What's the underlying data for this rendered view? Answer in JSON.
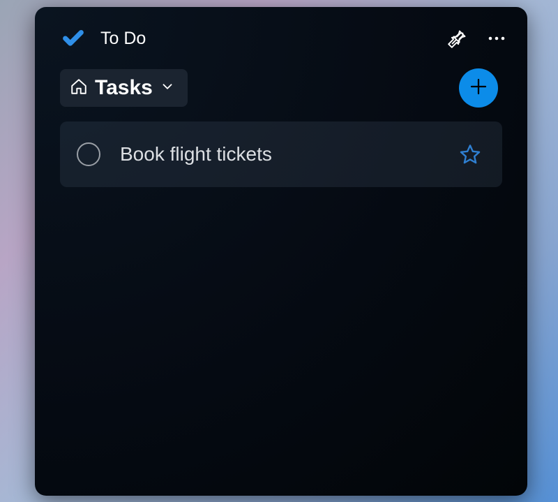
{
  "app": {
    "title": "To Do",
    "icon_name": "checkmark-icon"
  },
  "header_actions": {
    "pin": "pin-icon",
    "more": "more-icon"
  },
  "list": {
    "icon_name": "home-icon",
    "name": "Tasks",
    "chevron": "chevron-down-icon"
  },
  "add_button": {
    "icon_name": "plus-icon"
  },
  "tasks": [
    {
      "title": "Book flight tickets",
      "completed": false,
      "starred": false
    }
  ],
  "colors": {
    "accent": "#0c8ce9",
    "star_outline": "#2f7fd1"
  }
}
